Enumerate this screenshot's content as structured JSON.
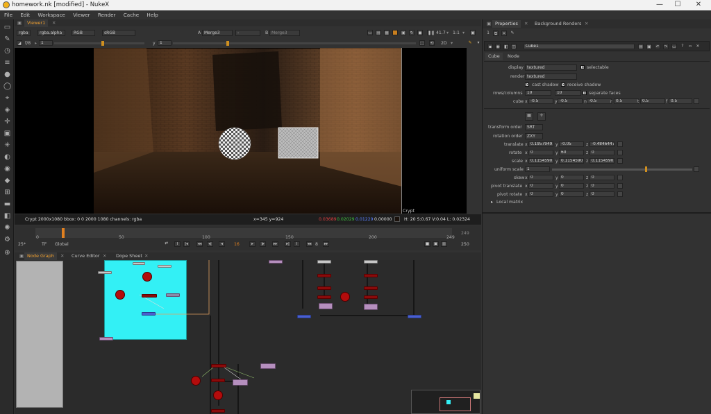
{
  "window": {
    "title": "homework.nk [modified] - NukeX",
    "minimize": "—",
    "maximize": "☐",
    "close": "✕"
  },
  "menu": [
    "File",
    "Edit",
    "Workspace",
    "Viewer",
    "Render",
    "Cache",
    "Help"
  ],
  "viewer": {
    "tab": "Viewer1",
    "channels": "rgba",
    "alpha": "rgba.alpha",
    "colorspace": "RGB",
    "lut": "sRGB",
    "a_label": "A",
    "a_input": "Merge3",
    "op": "-",
    "b_label": "B",
    "b_input": "Merge3",
    "zoom": "41.7",
    "ratio": "1:1",
    "fstop": "f/8",
    "gain": "1",
    "y_label": "y",
    "y_value": "1",
    "view_mode": "2D",
    "image_label": "Crypt",
    "info_format": "Crypt 2000x1080  bbox: 0 0 2000 1080 channels: rgba",
    "info_xy": "x=345 y=924",
    "info_r": "0.03689",
    "info_g": "0.02029",
    "info_b": "0.01229",
    "info_a": "0.00000",
    "info_hsvl": "H: 20 S:0.67 V:0.04  L: 0.02324",
    "colors": {
      "r": "#e04040",
      "g": "#40c040",
      "b": "#5a80ff"
    }
  },
  "timeline": {
    "ticks": [
      "0",
      "50",
      "100",
      "150",
      "200",
      "249"
    ],
    "start": "0",
    "end": "249",
    "end_right": "249",
    "fps": "25*",
    "tf": "TF",
    "range": "Global",
    "frame": "16",
    "step": "8",
    "out_frame": "250"
  },
  "panels": {
    "tabs": [
      "Node Graph",
      "Curve Editor",
      "Dope Sheet"
    ]
  },
  "properties": {
    "tabs": [
      "Properties",
      "Background Renders"
    ],
    "node_name": "Cube1",
    "subtabs": [
      "Cube",
      "Node"
    ],
    "display_label": "display",
    "display_value": "textured",
    "selectable": "selectable",
    "render_label": "render",
    "render_value": "textured",
    "cast_shadow": "cast shadow",
    "receive_shadow": "receive shadow",
    "rows_label": "rows/columns",
    "rows": "10",
    "columns": "10",
    "separate_faces": "separate faces",
    "cube_label": "cube",
    "cube": [
      [
        "x",
        "-0.5"
      ],
      [
        "y",
        "-0.5"
      ],
      [
        "n",
        "-0.5"
      ],
      [
        "r",
        "0.5"
      ],
      [
        "t",
        "0.5"
      ],
      [
        "f",
        "0.5"
      ]
    ],
    "transform_order_label": "transform order",
    "transform_order": "SRT",
    "rotation_order_label": "rotation order",
    "rotation_order": "ZXY",
    "translate_label": "translate",
    "translate": [
      [
        "x",
        "0.19579493"
      ],
      [
        "y",
        "-0.05"
      ],
      [
        "z",
        "-0.48464477"
      ]
    ],
    "rotate_label": "rotate",
    "rotate": [
      [
        "x",
        "0"
      ],
      [
        "y",
        "60"
      ],
      [
        "z",
        "0"
      ]
    ],
    "scale_label": "scale",
    "scale": [
      [
        "x",
        "0.11545905"
      ],
      [
        "y",
        "0.11545905"
      ],
      [
        "z",
        "0.11545905"
      ]
    ],
    "uniform_scale_label": "uniform scale",
    "uniform_scale": "1",
    "skew_label": "skew",
    "skew": [
      [
        "x",
        "0"
      ],
      [
        "y",
        "0"
      ],
      [
        "z",
        "0"
      ]
    ],
    "pivot_translate_label": "pivot translate",
    "pivot_translate": [
      [
        "x",
        "0"
      ],
      [
        "y",
        "0"
      ],
      [
        "z",
        "0"
      ]
    ],
    "pivot_rotate_label": "pivot rotate",
    "pivot_rotate": [
      [
        "x",
        "0"
      ],
      [
        "y",
        "0"
      ],
      [
        "z",
        "0"
      ]
    ],
    "local_matrix": "Local matrix"
  }
}
